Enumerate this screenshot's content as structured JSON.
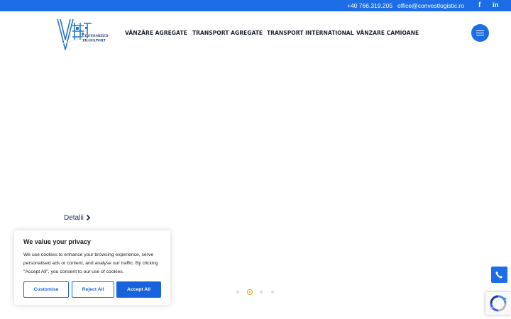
{
  "topbar": {
    "phone": "+40 766.319.205",
    "email": "office@convestlogistic.ro",
    "facebook_glyph": "f",
    "linkedin_glyph": "in"
  },
  "brand": {
    "logo_line1": "CUSTOMIZED",
    "logo_line2": "TRANSPORT",
    "colors": {
      "primary": "#1d6ee6",
      "accent": "#e79a1c",
      "logo_blue": "#2a76c9"
    }
  },
  "nav": {
    "items": [
      {
        "label": "VÂNZĂRE AGREGATE"
      },
      {
        "label": "TRANSPORT AGREGATE"
      },
      {
        "label": "TRANSPORT INTERNATIONAL"
      },
      {
        "label": "VÂNZARE CAMIOANE"
      }
    ],
    "menu_icon": "hamburger-icon"
  },
  "hero": {
    "details_label": "Detalii",
    "slides": {
      "count": 4,
      "active_index": 1
    }
  },
  "cookie": {
    "title": "We value your privacy",
    "text": "We use cookies to enhance your browsing experience, serve personalised ads or content, and analyse our traffic. By clicking \"Accept All\", you consent to our use of cookies.",
    "customise_label": "Customise",
    "reject_label": "Reject All",
    "accept_label": "Accept All",
    "colors": {
      "button": "#1863dc"
    }
  },
  "floating": {
    "call_icon": "phone-icon",
    "recaptcha_icon": "recaptcha-icon"
  }
}
